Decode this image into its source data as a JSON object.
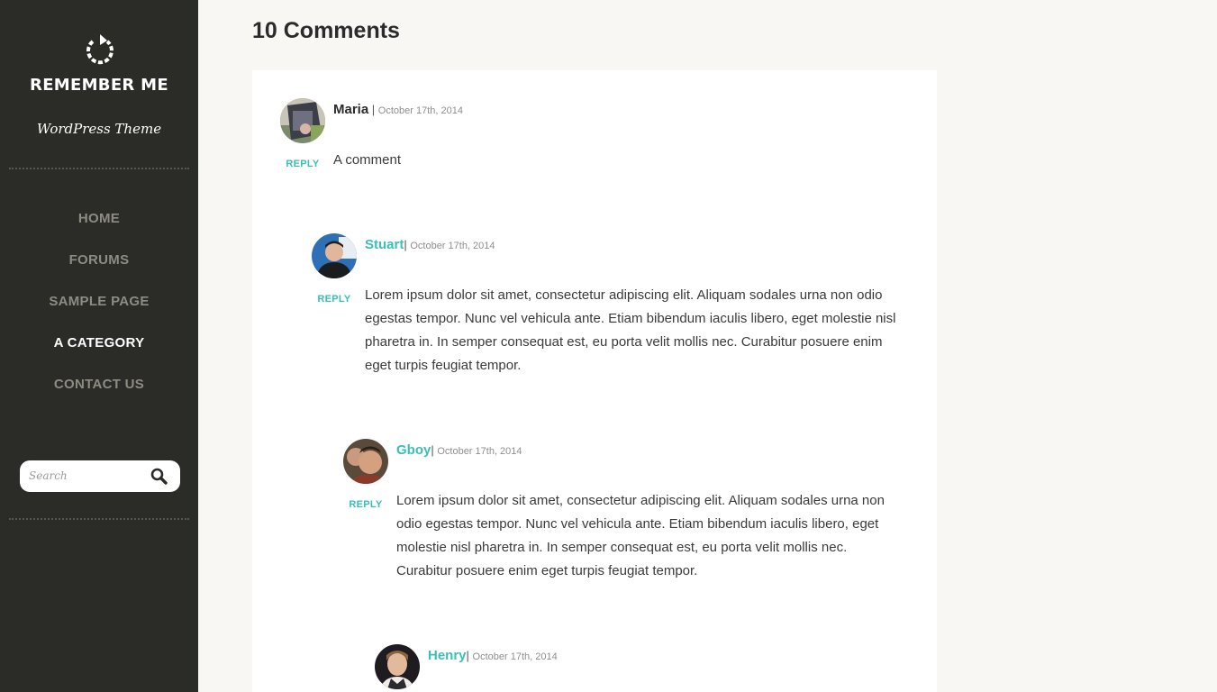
{
  "site": {
    "title": "REMEMBER ME",
    "tagline": "WordPress Theme",
    "logo_icon": "refresh-icon"
  },
  "nav": {
    "items": [
      {
        "label": "HOME",
        "active": false
      },
      {
        "label": "FORUMS",
        "active": false
      },
      {
        "label": "SAMPLE PAGE",
        "active": false
      },
      {
        "label": "A CATEGORY",
        "active": true
      },
      {
        "label": "CONTACT US",
        "active": false
      }
    ]
  },
  "search": {
    "placeholder": "Search",
    "icon": "search-icon"
  },
  "comments": {
    "heading": "10 Comments",
    "reply_label": "REPLY",
    "items": [
      {
        "author": "Maria",
        "date": "October 17th, 2014",
        "text": "A comment"
      },
      {
        "author": "Stuart",
        "date": "October 17th, 2014",
        "text": "Lorem ipsum dolor sit amet, consectetur adipiscing elit. Aliquam sodales urna non odio egestas tempor. Nunc vel vehicula ante. Etiam bibendum iaculis libero, eget molestie nisl pharetra in. In semper consequat est, eu porta velit mollis nec. Curabitur posuere enim eget turpis feugiat tempor."
      },
      {
        "author": "Gboy",
        "date": "October 17th, 2014",
        "text": "Lorem ipsum dolor sit amet, consectetur adipiscing elit. Aliquam sodales urna non odio egestas tempor. Nunc vel vehicula ante. Etiam bibendum iaculis libero, eget molestie nisl pharetra in. In semper consequat est, eu porta velit mollis nec. Curabitur posuere enim eget turpis feugiat tempor."
      },
      {
        "author": "Henry",
        "date": "October 17th, 2014",
        "text": ""
      }
    ]
  },
  "colors": {
    "sidebar_bg": "#2b2b28",
    "accent": "#3bbdb8",
    "nav_text": "#8d8c82",
    "page_bg": "#f8f7f4"
  }
}
